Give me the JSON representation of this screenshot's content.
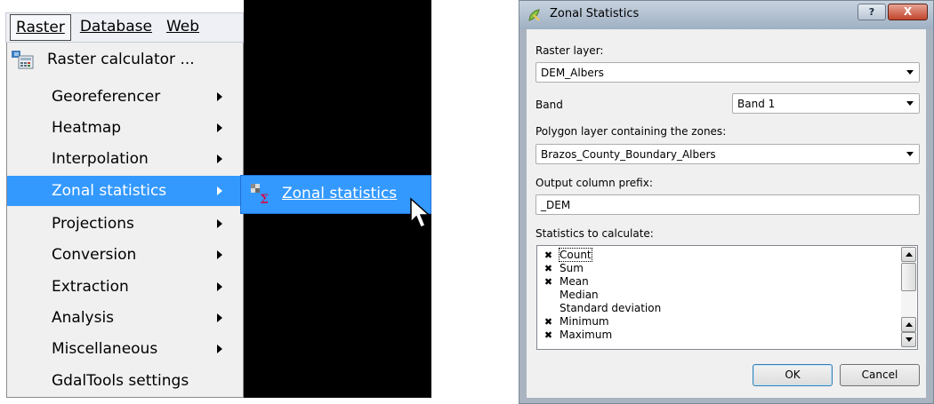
{
  "menubar": {
    "items": [
      {
        "label": "Raster",
        "active": true
      },
      {
        "label": "Database",
        "active": false
      },
      {
        "label": "Web",
        "active": false
      }
    ]
  },
  "raster_menu": {
    "items": [
      {
        "label": "Raster calculator ...",
        "icon": "raster-calculator-icon",
        "submenu": false
      },
      {
        "label": "Georeferencer",
        "submenu": true
      },
      {
        "label": "Heatmap",
        "submenu": true
      },
      {
        "label": "Interpolation",
        "submenu": true
      },
      {
        "label": "Zonal statistics",
        "submenu": true,
        "highlighted": true
      },
      {
        "label": "Projections",
        "submenu": true
      },
      {
        "label": "Conversion",
        "submenu": true
      },
      {
        "label": "Extraction",
        "submenu": true
      },
      {
        "label": "Analysis",
        "submenu": true
      },
      {
        "label": "Miscellaneous",
        "submenu": true
      },
      {
        "label": "GdalTools settings",
        "submenu": false
      }
    ]
  },
  "submenu": {
    "label": "Zonal statistics",
    "icon": "zonal-statistics-icon"
  },
  "dialog": {
    "title": "Zonal Statistics",
    "help_label": "?",
    "close_label": "X",
    "raster_layer_label": "Raster layer:",
    "raster_layer_value": "DEM_Albers",
    "band_label": "Band",
    "band_value": "Band 1",
    "polygon_label": "Polygon layer containing the zones:",
    "polygon_value": "Brazos_County_Boundary_Albers",
    "prefix_label": "Output column prefix:",
    "prefix_value": "_DEM",
    "stats_label": "Statistics to calculate:",
    "stats": [
      {
        "label": "Count",
        "checked": true
      },
      {
        "label": "Sum",
        "checked": true
      },
      {
        "label": "Mean",
        "checked": true
      },
      {
        "label": "Median",
        "checked": false
      },
      {
        "label": "Standard deviation",
        "checked": false
      },
      {
        "label": "Minimum",
        "checked": true
      },
      {
        "label": "Maximum",
        "checked": true
      }
    ],
    "ok_label": "OK",
    "cancel_label": "Cancel"
  },
  "colors": {
    "highlight": "#3399ff",
    "menu_bg": "#f0f0f0",
    "dialog_bg": "#f0f0f0"
  }
}
